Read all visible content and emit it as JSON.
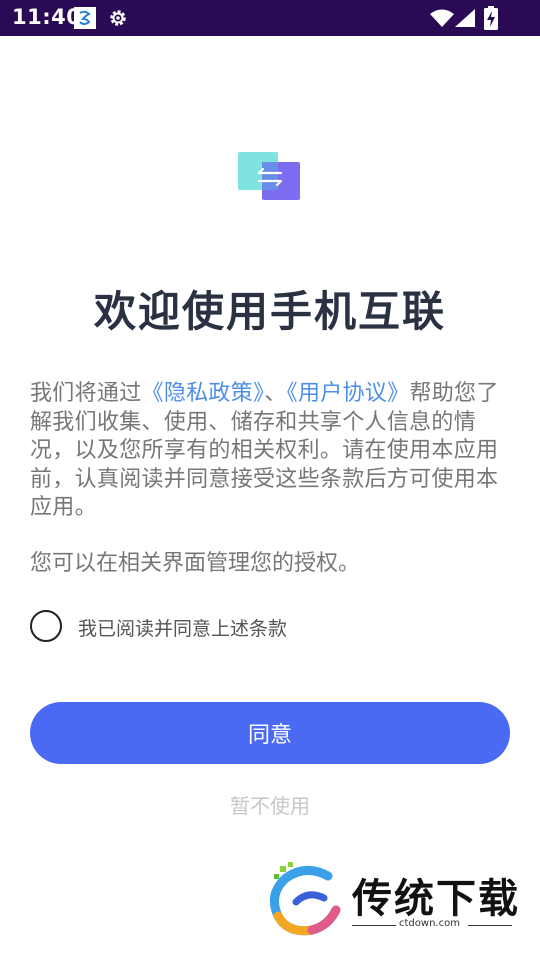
{
  "status_bar": {
    "time": "11:40",
    "icons": [
      "notification-app-icon",
      "gear-icon",
      "wifi-icon",
      "cell-signal-icon",
      "battery-charging-icon"
    ]
  },
  "welcome": {
    "title": "欢迎使用手机互联",
    "intro_part1": "我们将通过",
    "privacy_link": "《隐私政策》",
    "separator": "、",
    "agreement_link": "《用户协议》",
    "intro_part2": "帮助您了解我们收集、使用、储存和共享个人信息的情况，以及您所享有的相关权利。请在使用本应用前，认真阅读并同意接受这些条款后方可使用本应用。",
    "manage_text": "您可以在相关界面管理您的授权。"
  },
  "consent": {
    "checkbox_label": "我已阅读并同意上述条款",
    "checked": false
  },
  "actions": {
    "agree_label": "同意",
    "decline_label": "暂不使用"
  },
  "watermark": {
    "name": "传统下载",
    "url": "ctdown.com"
  },
  "colors": {
    "status_bar": "#2a0a55",
    "title": "#2a3142",
    "body_text": "#777777",
    "link": "#4e8fe8",
    "primary_button": "#4a6af4",
    "secondary_text": "#c7c7c7"
  }
}
